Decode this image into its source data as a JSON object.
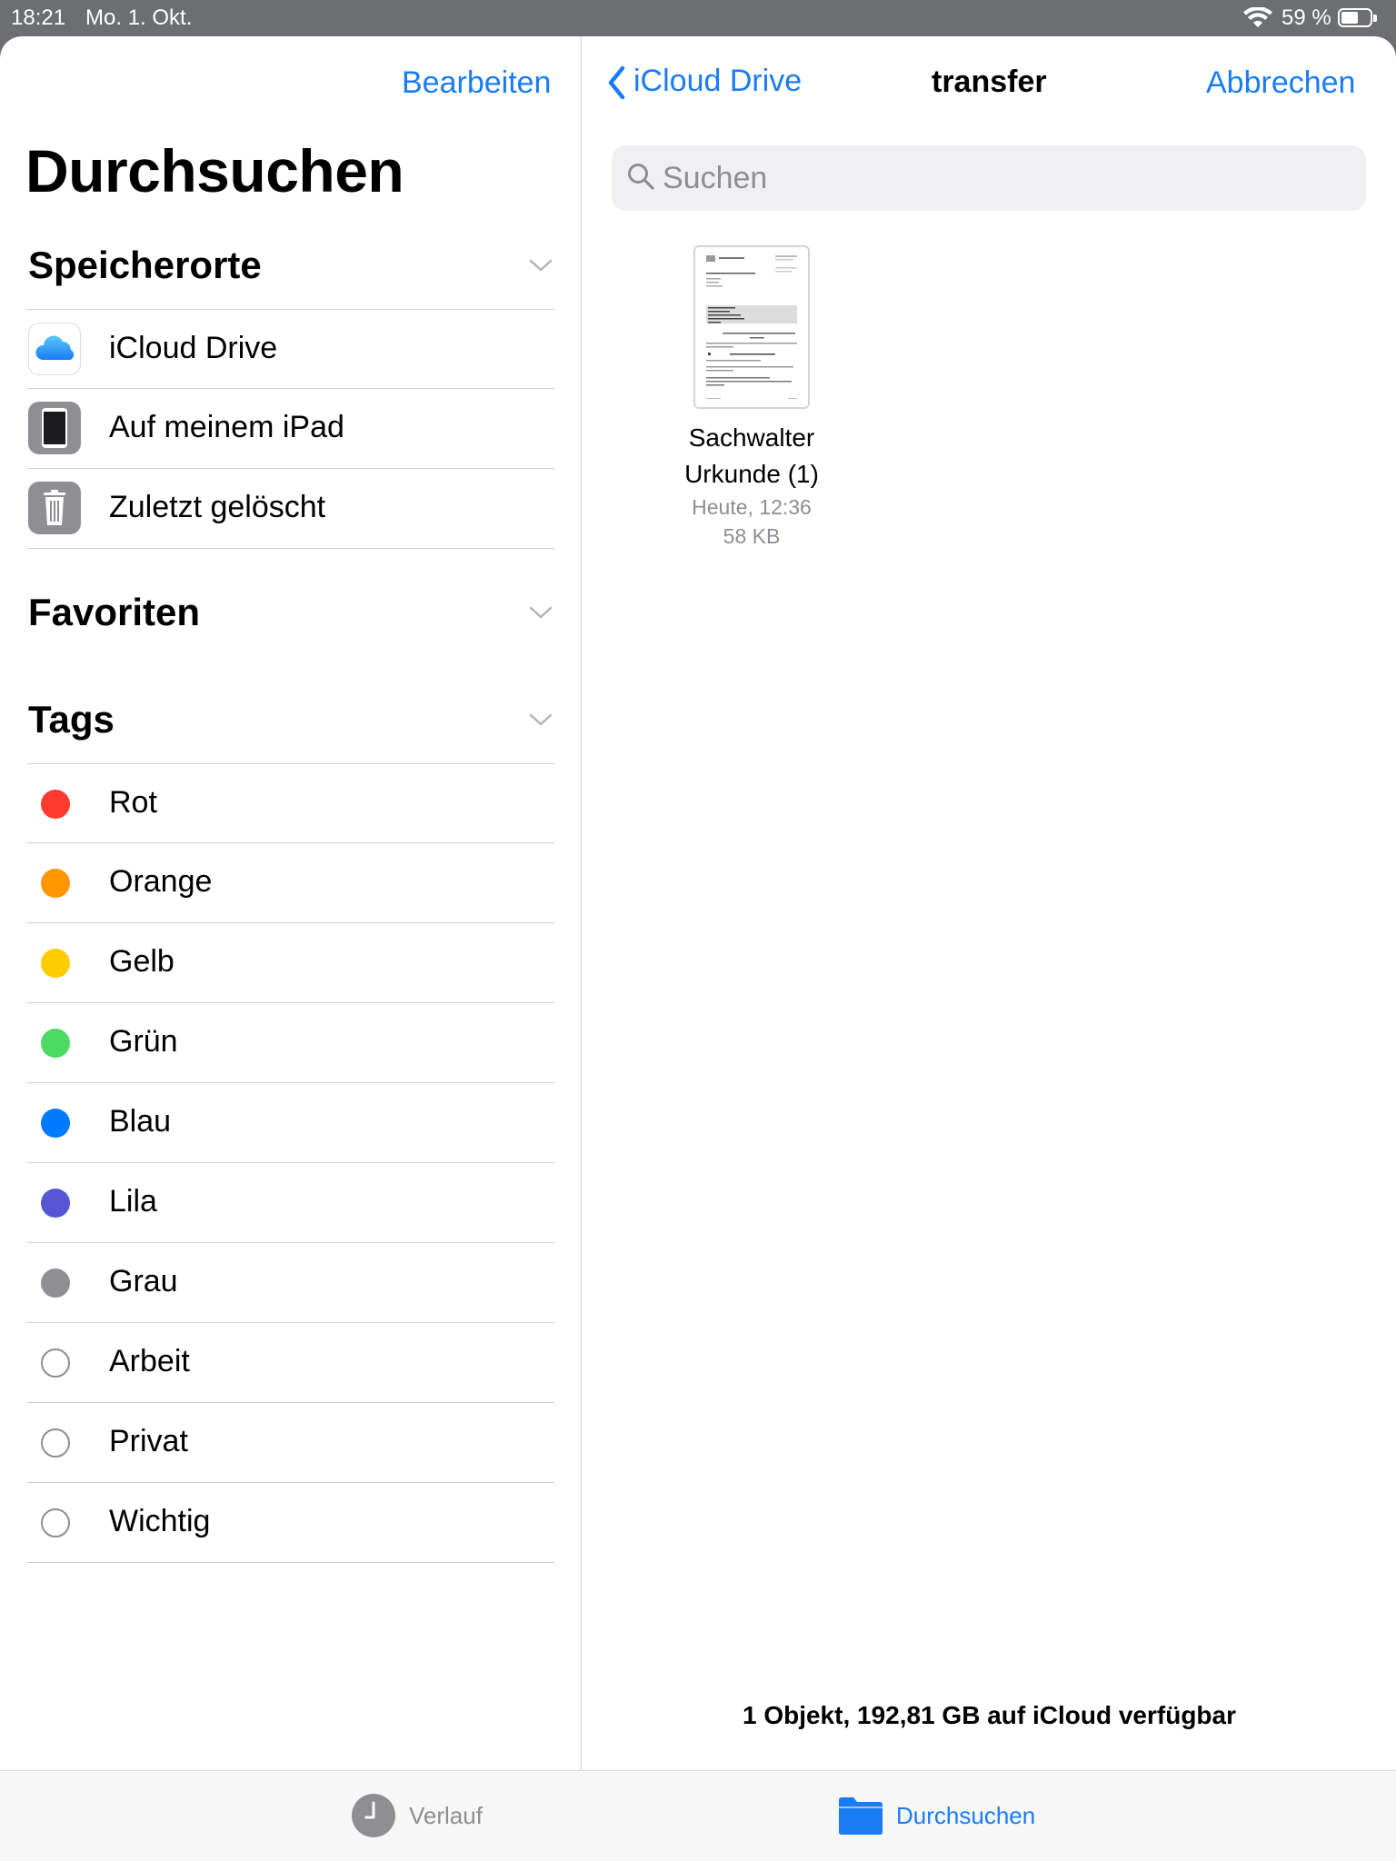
{
  "status_bar": {
    "time": "18:21",
    "date": "Mo. 1. Okt.",
    "battery_percent": "59 %",
    "battery_level": 0.59,
    "icons": [
      "wifi-icon",
      "battery-icon"
    ]
  },
  "sidebar": {
    "edit_label": "Bearbeiten",
    "title": "Durchsuchen",
    "sections": {
      "locations": {
        "title": "Speicherorte",
        "items": [
          {
            "label": "iCloud Drive",
            "icon": "icloud-icon"
          },
          {
            "label": "Auf meinem iPad",
            "icon": "ipad-icon"
          },
          {
            "label": "Zuletzt gelöscht",
            "icon": "trash-icon"
          }
        ]
      },
      "favorites": {
        "title": "Favoriten"
      },
      "tags": {
        "title": "Tags",
        "items": [
          {
            "label": "Rot",
            "color": "#ff3b30"
          },
          {
            "label": "Orange",
            "color": "#ff9500"
          },
          {
            "label": "Gelb",
            "color": "#ffcc00"
          },
          {
            "label": "Grün",
            "color": "#4cd964"
          },
          {
            "label": "Blau",
            "color": "#007aff"
          },
          {
            "label": "Lila",
            "color": "#5856d6"
          },
          {
            "label": "Grau",
            "color": "#8e8e93"
          },
          {
            "label": "Arbeit",
            "color": ""
          },
          {
            "label": "Privat",
            "color": ""
          },
          {
            "label": "Wichtig",
            "color": ""
          }
        ]
      }
    }
  },
  "main": {
    "back_label": "iCloud Drive",
    "title": "transfer",
    "cancel_label": "Abbrechen",
    "search_placeholder": "Suchen",
    "files": [
      {
        "name_line1": "Sachwalter",
        "name_line2": "Urkunde (1)",
        "date": "Heute, 12:36",
        "size": "58 KB"
      }
    ],
    "footer": "1 Objekt, 192,81 GB auf iCloud verfügbar"
  },
  "tabbar": {
    "recents_label": "Verlauf",
    "browse_label": "Durchsuchen"
  },
  "colors": {
    "accent": "#1a7cf5",
    "separator": "#cfcfd3",
    "secondary_text": "#8e8e93"
  }
}
